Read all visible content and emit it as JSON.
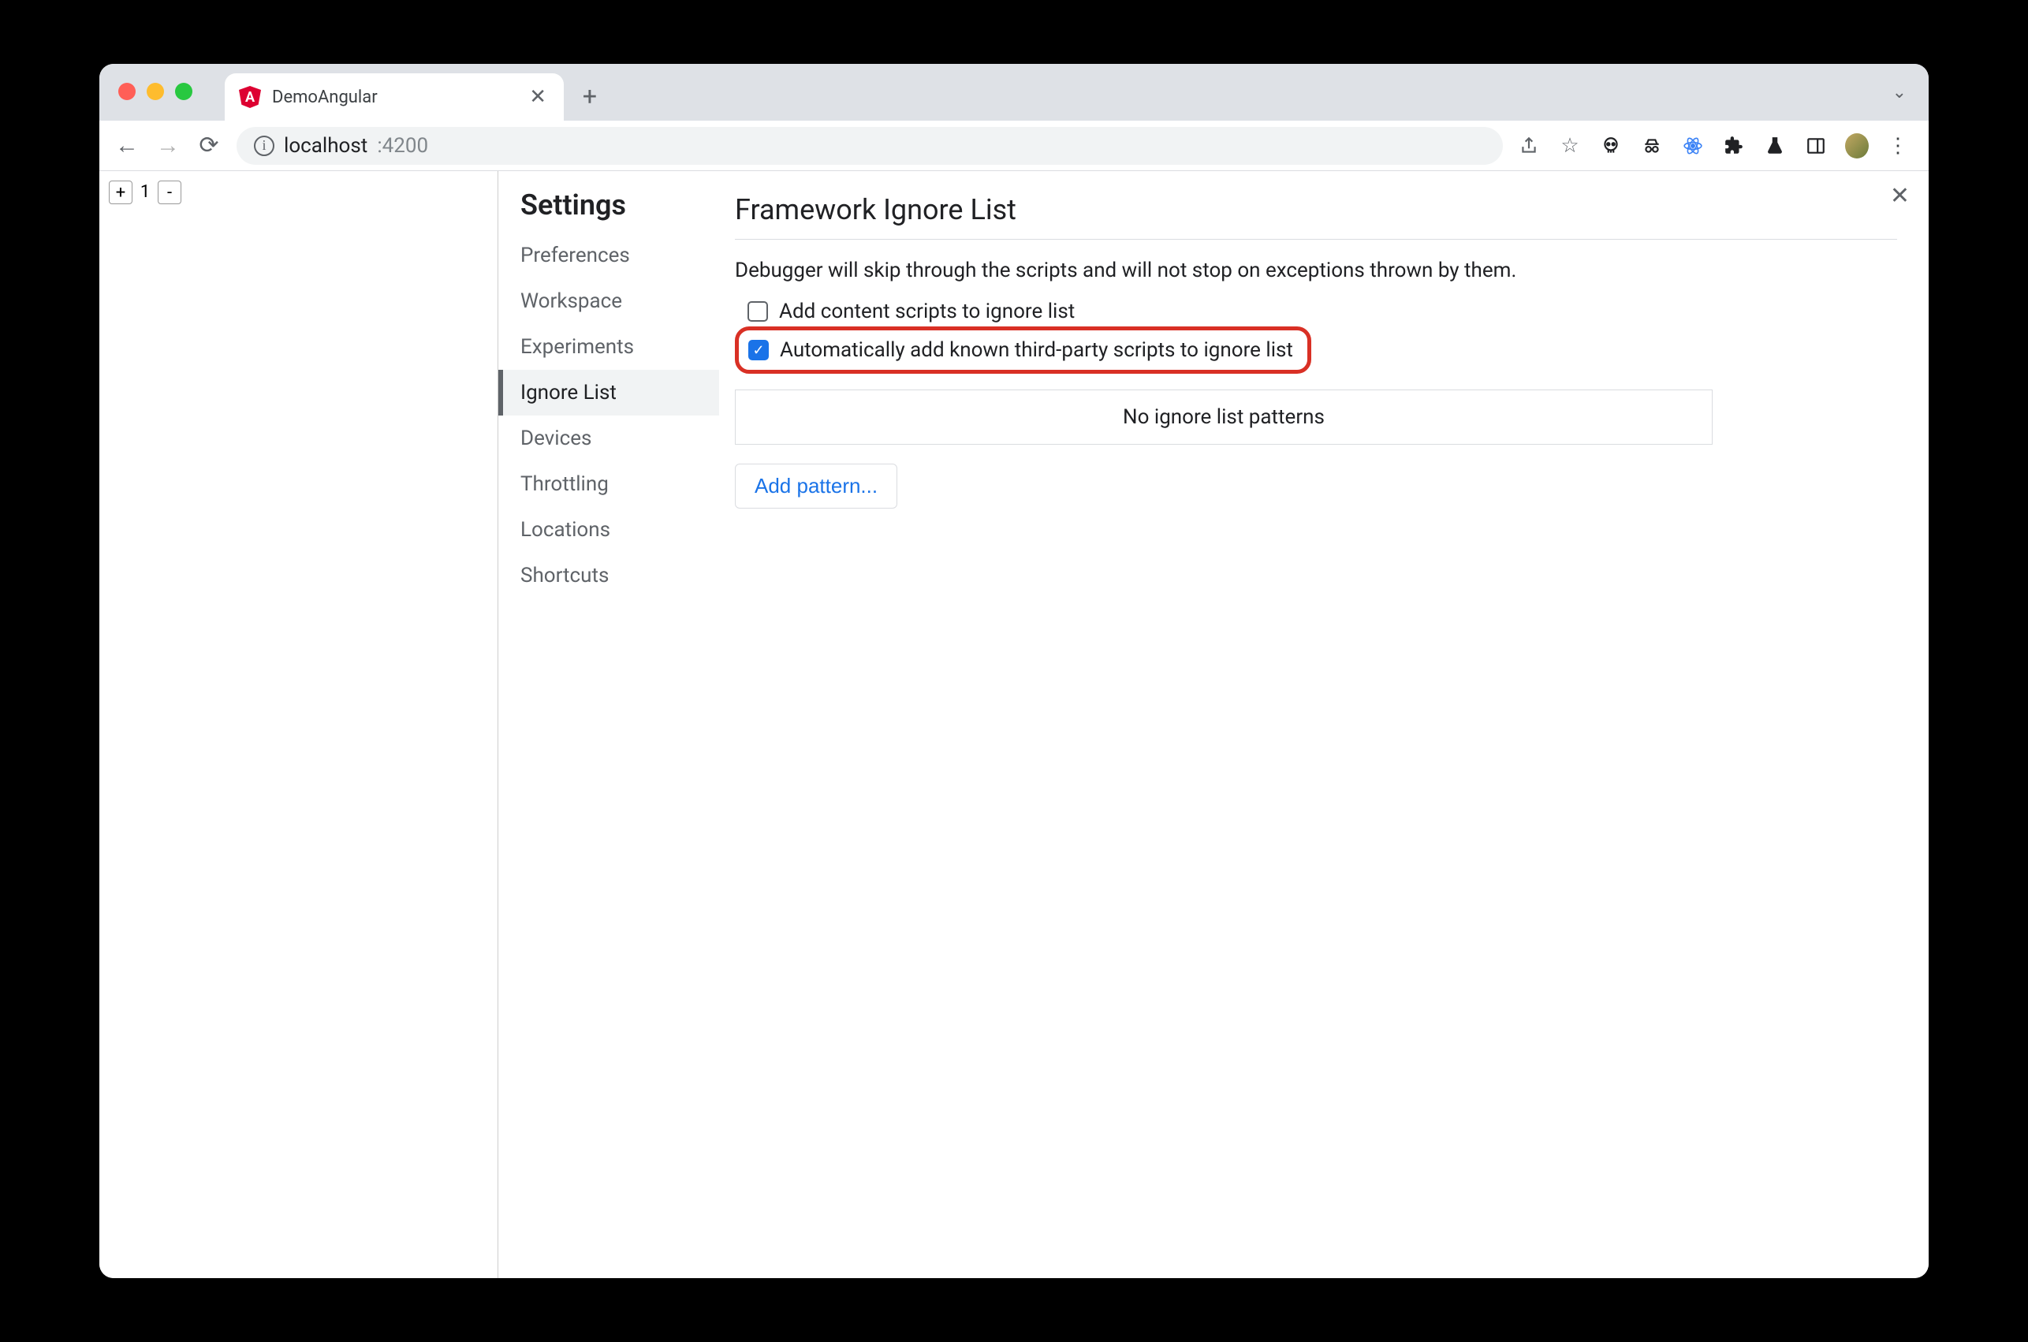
{
  "browser": {
    "tab_title": "DemoAngular",
    "url_host": "localhost",
    "url_port": ":4200"
  },
  "page": {
    "counter_value": "1"
  },
  "settings": {
    "title": "Settings",
    "nav": {
      "preferences": "Preferences",
      "workspace": "Workspace",
      "experiments": "Experiments",
      "ignore_list": "Ignore List",
      "devices": "Devices",
      "throttling": "Throttling",
      "locations": "Locations",
      "shortcuts": "Shortcuts"
    }
  },
  "panel": {
    "title": "Framework Ignore List",
    "description": "Debugger will skip through the scripts and will not stop on exceptions thrown by them.",
    "option_content_scripts": "Add content scripts to ignore list",
    "option_third_party": "Automatically add known third-party scripts to ignore list",
    "empty_patterns": "No ignore list patterns",
    "add_pattern_label": "Add pattern..."
  }
}
